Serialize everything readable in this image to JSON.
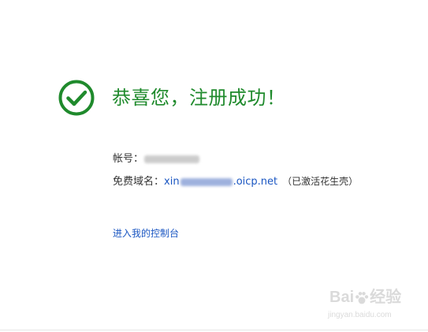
{
  "success": {
    "icon": "check-circle-icon",
    "accent_color": "#1f8a2c",
    "title": "恭喜您，注册成功！"
  },
  "account": {
    "label": "帐号："
  },
  "domain": {
    "label": "免费域名：",
    "prefix": "xin",
    "suffix": ".oicp.net",
    "status": "（已激活花生壳）",
    "link_color": "#1a56c2"
  },
  "actions": {
    "console_link": "进入我的控制台"
  },
  "watermark": {
    "brand_left": "Bai",
    "brand_right": "经验",
    "url": "jingyan.baidu.com"
  }
}
